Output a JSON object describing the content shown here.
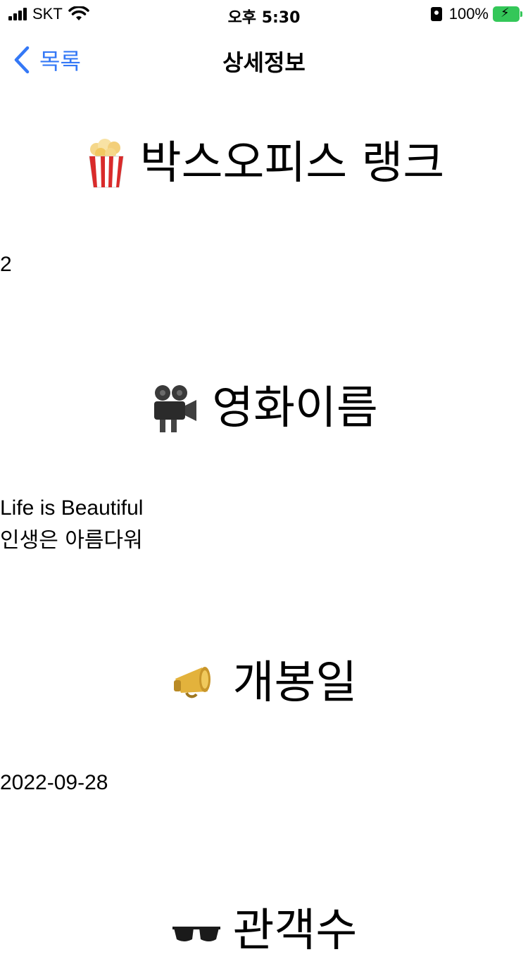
{
  "status_bar": {
    "carrier": "SKT",
    "time": "오후 5:30",
    "battery": "100%"
  },
  "nav": {
    "back_label": "목록",
    "title": "상세정보"
  },
  "sections": {
    "rank": {
      "heading": "박스오피스 랭크",
      "icon": "popcorn-icon",
      "value": "2"
    },
    "name": {
      "heading": "영화이름",
      "icon": "movie-camera-icon",
      "value_en": "Life is Beautiful",
      "value_ko": "인생은 아름다워"
    },
    "release": {
      "heading": "개봉일",
      "icon": "megaphone-icon",
      "value": "2022-09-28"
    },
    "audience": {
      "heading": "관객수",
      "icon": "sunglasses-icon"
    }
  },
  "colors": {
    "accent": "#3478f6",
    "battery": "#34c759"
  }
}
